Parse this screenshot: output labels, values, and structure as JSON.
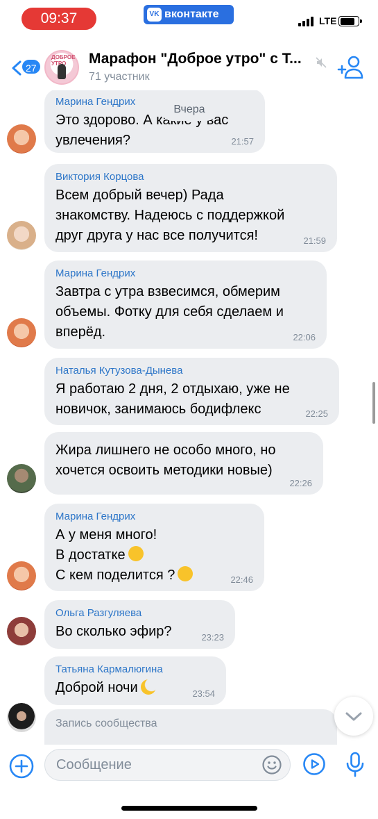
{
  "status_bar": {
    "time": "09:37",
    "app_badge": "вконтакте",
    "network": "LTE"
  },
  "header": {
    "unread_count": "27",
    "title": "Марафон \"Доброе утро\" с Т...",
    "subtitle": "71 участник",
    "avatar_text": "ДОБРОЕ УТРО"
  },
  "date_separator": "Вчера",
  "messages": [
    {
      "sender": "Марина Гендрих",
      "lines": [
        "Это здорово. А какие у вас",
        "увлечения?"
      ],
      "time": "21:57"
    },
    {
      "sender": "Виктория Корцова",
      "lines": [
        "Всем добрый вечер) Рада",
        "знакомству. Надеюсь с поддержкой",
        "друг друга у нас все получится!"
      ],
      "time": "21:59"
    },
    {
      "sender": "Марина Гендрих",
      "lines": [
        "Завтра с утра взвесимся, обмерим",
        "объемы. Фотку для себя сделаем и",
        "вперёд."
      ],
      "time": "22:06"
    },
    {
      "sender": "Наталья Кутузова-Дынева",
      "lines": [
        "Я работаю 2 дня, 2 отдыхаю, уже не",
        "новичок, занимаюсь бодифлекс"
      ],
      "time": "22:25"
    },
    {
      "sender": "",
      "lines": [
        "Жира лишнего не особо много, но",
        "хочется освоить методики новые)"
      ],
      "time": "22:26"
    },
    {
      "sender": "Марина Гендрих",
      "lines": [
        "А у меня много!",
        "В достатке",
        "С кем поделится ?"
      ],
      "time": "22:46"
    },
    {
      "sender": "Ольга Разгуляева",
      "lines": [
        "Во сколько эфир?"
      ],
      "time": "23:23"
    },
    {
      "sender": "Татьяна Кармалюгина",
      "lines": [
        "Доброй ночи"
      ],
      "time": "23:54"
    },
    {
      "sender": "",
      "lines": [
        "Запись сообщества"
      ],
      "time": ""
    }
  ],
  "composer": {
    "placeholder": "Сообщение"
  },
  "colors": {
    "accent": "#2787f5",
    "sender_name": "#2d76c8",
    "bubble": "#ebedf0",
    "time_pill": "#e53935"
  },
  "icons": [
    "back-arrow-icon",
    "mute-icon",
    "add-member-icon",
    "plus-circle-icon",
    "emoji-icon",
    "video-message-icon",
    "microphone-icon",
    "chevron-down-icon"
  ]
}
